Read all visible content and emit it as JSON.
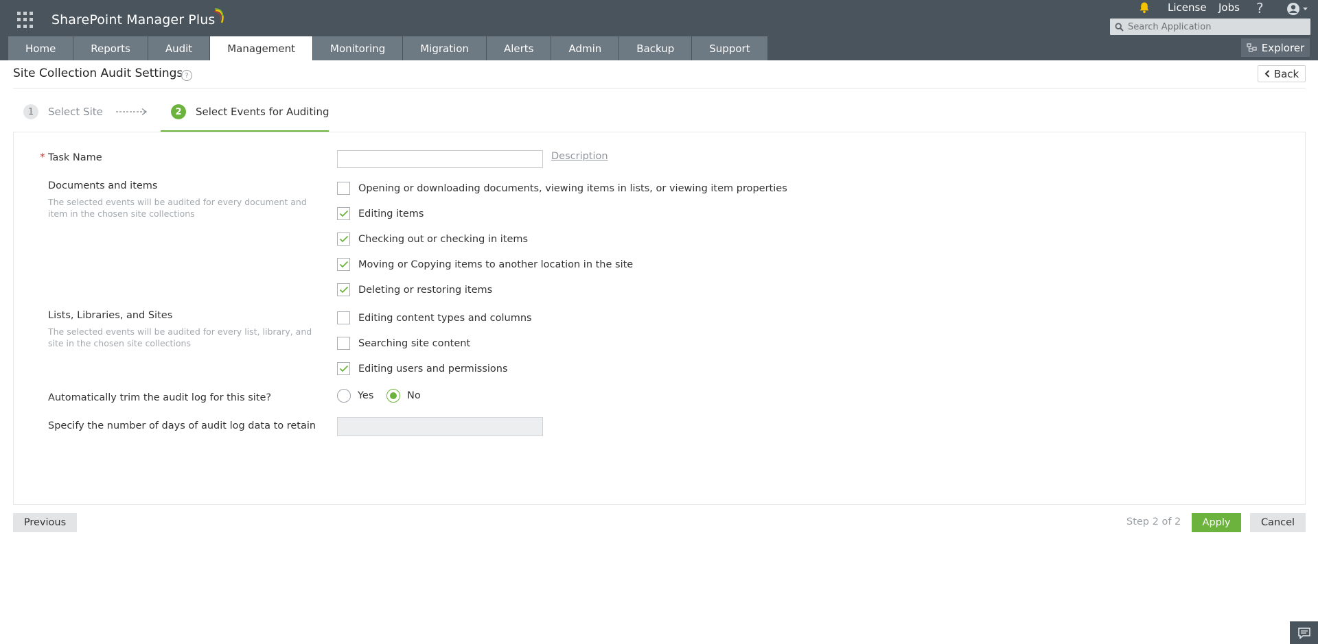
{
  "header": {
    "brand": "SharePoint Manager Plus",
    "links": {
      "license": "License",
      "jobs": "Jobs",
      "help": "?"
    },
    "search": {
      "placeholder": "Search Application"
    },
    "explorer": "Explorer",
    "icons": [
      "app-grid-icon",
      "bell-icon",
      "help-icon",
      "user-icon",
      "search-icon",
      "explorer-icon"
    ],
    "accent": "#6cb33e",
    "header_bg": "#4a545d",
    "bell_color": "#f5c400"
  },
  "nav": {
    "tabs": [
      {
        "label": "Home",
        "active": false
      },
      {
        "label": "Reports",
        "active": false
      },
      {
        "label": "Audit",
        "active": false
      },
      {
        "label": "Management",
        "active": true
      },
      {
        "label": "Monitoring",
        "active": false
      },
      {
        "label": "Migration",
        "active": false
      },
      {
        "label": "Alerts",
        "active": false
      },
      {
        "label": "Admin",
        "active": false
      },
      {
        "label": "Backup",
        "active": false
      },
      {
        "label": "Support",
        "active": false
      }
    ]
  },
  "page": {
    "title": "Site Collection Audit Settings",
    "help": "?",
    "back": "Back"
  },
  "wizard": {
    "steps": [
      {
        "number": "1",
        "label": "Select Site",
        "active": false
      },
      {
        "number": "2",
        "label": "Select Events for Auditing",
        "active": true
      }
    ]
  },
  "form": {
    "required_mark": "*",
    "task_name": {
      "label": "Task Name",
      "value": "",
      "description_link": "Description"
    },
    "documents": {
      "label": "Documents and items",
      "help": "The selected events will be audited for every document and item in the chosen site collections",
      "options": [
        {
          "label": "Opening or downloading documents, viewing items in lists, or viewing item properties",
          "checked": false
        },
        {
          "label": "Editing items",
          "checked": true
        },
        {
          "label": "Checking out or checking in items",
          "checked": true
        },
        {
          "label": "Moving or Copying items to another location in the site",
          "checked": true
        },
        {
          "label": "Deleting or restoring items",
          "checked": true
        }
      ]
    },
    "lists": {
      "label": "Lists, Libraries, and Sites",
      "help": "The selected events will be audited for every list, library, and site in the chosen site collections",
      "options": [
        {
          "label": "Editing content types and columns",
          "checked": false
        },
        {
          "label": "Searching site content",
          "checked": false
        },
        {
          "label": "Editing users and permissions",
          "checked": true
        }
      ]
    },
    "trim": {
      "label": "Automatically trim the audit log for this site?",
      "yes": "Yes",
      "no": "No",
      "selected": "No"
    },
    "days": {
      "label": "Specify the number of days of audit log data to retain",
      "value": ""
    }
  },
  "footer": {
    "previous": "Previous",
    "step_count": "Step 2 of 2",
    "apply": "Apply",
    "cancel": "Cancel"
  }
}
